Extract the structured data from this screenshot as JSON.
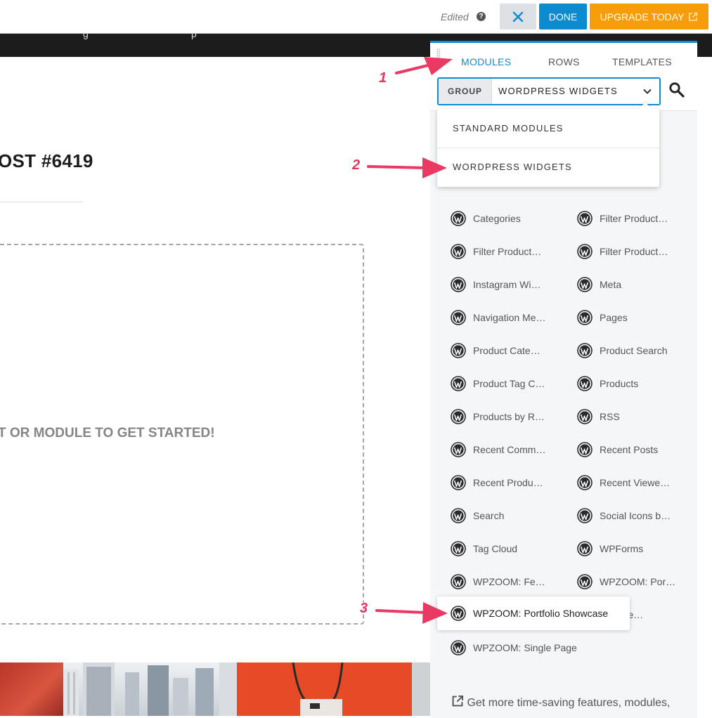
{
  "topbar": {
    "edited_label": "Edited",
    "help_icon_glyph": "?",
    "close_icon": "close-x-icon",
    "done_label": "DONE",
    "upgrade_label": "UPGRADE TODAY",
    "upgrade_icon": "external-link-icon",
    "accent_color": "#0d8bd1",
    "upgrade_color": "#f79c0b"
  },
  "page": {
    "post_title": "OST #6419",
    "drop_zone_text": "T OR MODULE TO GET STARTED!"
  },
  "panel": {
    "tabs": [
      {
        "label": "MODULES",
        "active": true
      },
      {
        "label": "ROWS",
        "active": false
      },
      {
        "label": "TEMPLATES",
        "active": false
      }
    ],
    "group_label": "GROUP",
    "group_value": "WORDPRESS WIDGETS",
    "search_icon": "search-icon",
    "dropdown_options": [
      "STANDARD MODULES",
      "WORDPRESS WIDGETS"
    ],
    "modules": [
      "Categories",
      "Filter Product…",
      "Filter Product…",
      "Filter Product…",
      "Instagram Wi…",
      "Meta",
      "Navigation Me…",
      "Pages",
      "Product Cate…",
      "Product Search",
      "Product Tag C…",
      "Products",
      "Products by R…",
      "RSS",
      "Recent Comm…",
      "Recent Posts",
      "Recent Produ…",
      "Recent Viewe…",
      "Search",
      "Social Icons b…",
      "Tag Cloud",
      "WPForms",
      "WPZOOM: Fe…",
      "WPZOOM: Por…",
      "WPZOOM: Portfolio Showcase",
      "OM: Re…",
      "WPZOOM: Single Page"
    ],
    "footer_text": "Get more time-saving features, modules,",
    "footer_icon": "external-link-icon"
  },
  "annotations": [
    "1",
    "2",
    "3"
  ]
}
